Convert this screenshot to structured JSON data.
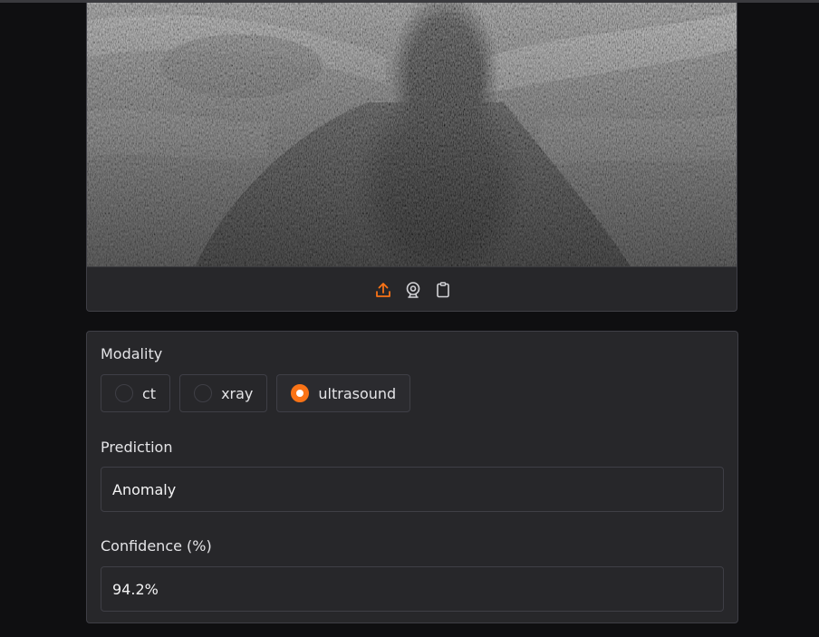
{
  "image_upload": {
    "tools": [
      {
        "icon": "upload-icon",
        "color": "#f97316"
      },
      {
        "icon": "webcam-icon",
        "color": "#d4d4d8"
      },
      {
        "icon": "clipboard-icon",
        "color": "#d4d4d8"
      }
    ]
  },
  "modality": {
    "label": "Modality",
    "options": [
      "ct",
      "xray",
      "ultrasound"
    ],
    "selected": "ultrasound"
  },
  "prediction": {
    "label": "Prediction",
    "value": "Anomaly"
  },
  "confidence": {
    "label": "Confidence (%)",
    "value": "94.2%"
  },
  "colors": {
    "accent": "#f97316",
    "panel": "#27272a",
    "background": "#0f0f11"
  }
}
